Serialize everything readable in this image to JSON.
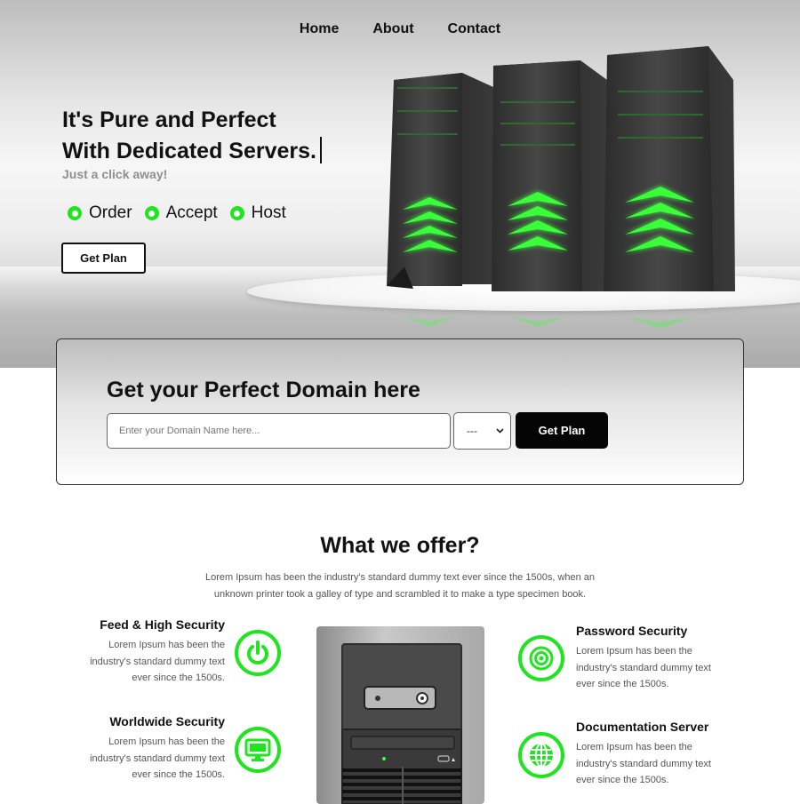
{
  "nav": {
    "items": [
      "Home",
      "About",
      "Contact"
    ]
  },
  "hero": {
    "title_line1": "It's Pure and Perfect",
    "title_line2": "With Dedicated Servers.",
    "subtitle": "Just a click away!",
    "steps": [
      "Order",
      "Accept",
      "Host"
    ],
    "cta_label": "Get Plan"
  },
  "domain": {
    "title": "Get your Perfect Domain here",
    "input_placeholder": "Enter your Domain Name here...",
    "select_value": "---",
    "button_label": "Get Plan"
  },
  "offer": {
    "title": "What we offer?",
    "description": "Lorem Ipsum has been the industry's standard dummy text ever since the 1500s, when an unknown printer took a galley of type and scrambled it to make a type specimen book.",
    "features": [
      {
        "title": "Feed & High Security",
        "text": "Lorem Ipsum has been the industry's standard dummy text ever since the 1500s.",
        "icon": "power-icon"
      },
      {
        "title": "Worldwide Security",
        "text": "Lorem Ipsum has been the industry's standard dummy text ever since the 1500s.",
        "icon": "monitor-icon"
      },
      {
        "title": "Password Security",
        "text": "Lorem Ipsum has been the industry's standard dummy text ever since the 1500s.",
        "icon": "target-icon"
      },
      {
        "title": "Documentation Server",
        "text": "Lorem Ipsum has been the industry's standard dummy text ever since the 1500s.",
        "icon": "globe-icon"
      }
    ]
  },
  "colors": {
    "accent": "#1ee51e",
    "dark": "#050505"
  }
}
